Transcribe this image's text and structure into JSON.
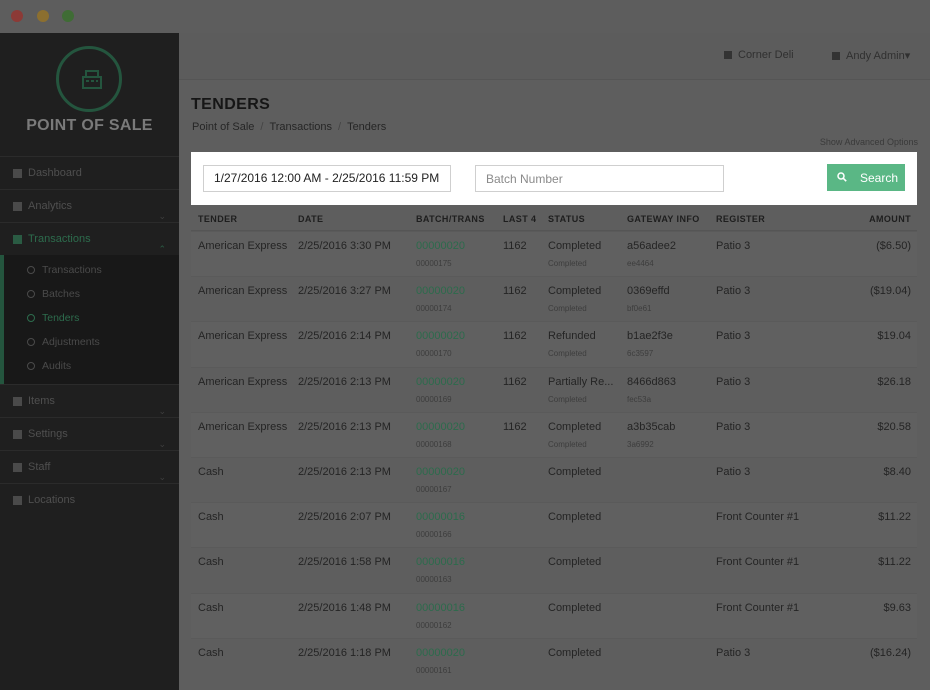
{
  "app": {
    "logo_text": "POINT OF SALE"
  },
  "sidebar": {
    "items": [
      {
        "label": "Dashboard",
        "icon": "dashboard-icon",
        "chevron": false
      },
      {
        "label": "Analytics",
        "icon": "chart-icon",
        "chevron": true
      },
      {
        "label": "Transactions",
        "icon": "cash-icon",
        "chevron": true,
        "active": true
      },
      {
        "label": "Items",
        "icon": "cart-icon",
        "chevron": true
      },
      {
        "label": "Settings",
        "icon": "sliders-icon",
        "chevron": true
      },
      {
        "label": "Staff",
        "icon": "users-icon",
        "chevron": true
      },
      {
        "label": "Locations",
        "icon": "home-icon",
        "chevron": false
      }
    ],
    "subitems": [
      {
        "label": "Transactions"
      },
      {
        "label": "Batches"
      },
      {
        "label": "Tenders",
        "active": true
      },
      {
        "label": "Adjustments"
      },
      {
        "label": "Audits"
      }
    ]
  },
  "topbar": {
    "store": "Corner Deli",
    "user": "Andy Admin",
    "user_caret": "▾"
  },
  "page": {
    "title": "TENDERS",
    "breadcrumb": [
      "Point of Sale",
      "Transactions",
      "Tenders"
    ],
    "breadcrumb_sep": "/",
    "advanced_link": "Show Advanced Options"
  },
  "search": {
    "date_range": "1/27/2016 12:00 AM - 2/25/2016 11:59 PM",
    "batch_placeholder": "Batch Number",
    "button_label": "Search"
  },
  "table": {
    "columns": [
      "TENDER",
      "DATE",
      "BATCH/TRANS",
      "LAST 4",
      "STATUS",
      "GATEWAY INFO",
      "REGISTER",
      "AMOUNT"
    ],
    "rows": [
      {
        "tender": "American Express",
        "date": "2/25/2016 3:30 PM",
        "batch": "00000020",
        "trans": "00000175",
        "last4": "1162",
        "status": "Completed",
        "status_sub": "Completed",
        "gateway": "a56adee2",
        "gateway_sub": "ee4464",
        "register": "Patio 3",
        "amount": "($6.50)"
      },
      {
        "tender": "American Express",
        "date": "2/25/2016 3:27 PM",
        "batch": "00000020",
        "trans": "00000174",
        "last4": "1162",
        "status": "Completed",
        "status_sub": "Completed",
        "gateway": "0369effd",
        "gateway_sub": "bf0e61",
        "register": "Patio 3",
        "amount": "($19.04)"
      },
      {
        "tender": "American Express",
        "date": "2/25/2016 2:14 PM",
        "batch": "00000020",
        "trans": "00000170",
        "last4": "1162",
        "status": "Refunded",
        "status_sub": "Completed",
        "gateway": "b1ae2f3e",
        "gateway_sub": "6c3597",
        "register": "Patio 3",
        "amount": "$19.04"
      },
      {
        "tender": "American Express",
        "date": "2/25/2016 2:13 PM",
        "batch": "00000020",
        "trans": "00000169",
        "last4": "1162",
        "status": "Partially Re...",
        "status_sub": "Completed",
        "gateway": "8466d863",
        "gateway_sub": "fec53a",
        "register": "Patio 3",
        "amount": "$26.18"
      },
      {
        "tender": "American Express",
        "date": "2/25/2016 2:13 PM",
        "batch": "00000020",
        "trans": "00000168",
        "last4": "1162",
        "status": "Completed",
        "status_sub": "Completed",
        "gateway": "a3b35cab",
        "gateway_sub": "3a6992",
        "register": "Patio 3",
        "amount": "$20.58"
      },
      {
        "tender": "Cash",
        "date": "2/25/2016 2:13 PM",
        "batch": "00000020",
        "trans": "00000167",
        "last4": "",
        "status": "Completed",
        "status_sub": "",
        "gateway": "",
        "gateway_sub": "",
        "register": "Patio 3",
        "amount": "$8.40"
      },
      {
        "tender": "Cash",
        "date": "2/25/2016 2:07 PM",
        "batch": "00000016",
        "trans": "00000166",
        "last4": "",
        "status": "Completed",
        "status_sub": "",
        "gateway": "",
        "gateway_sub": "",
        "register": "Front Counter #1",
        "amount": "$11.22"
      },
      {
        "tender": "Cash",
        "date": "2/25/2016 1:58 PM",
        "batch": "00000016",
        "trans": "00000163",
        "last4": "",
        "status": "Completed",
        "status_sub": "",
        "gateway": "",
        "gateway_sub": "",
        "register": "Front Counter #1",
        "amount": "$11.22"
      },
      {
        "tender": "Cash",
        "date": "2/25/2016 1:48 PM",
        "batch": "00000016",
        "trans": "00000162",
        "last4": "",
        "status": "Completed",
        "status_sub": "",
        "gateway": "",
        "gateway_sub": "",
        "register": "Front Counter #1",
        "amount": "$9.63"
      },
      {
        "tender": "Cash",
        "date": "2/25/2016 1:18 PM",
        "batch": "00000020",
        "trans": "00000161",
        "last4": "",
        "status": "Completed",
        "status_sub": "",
        "gateway": "",
        "gateway_sub": "",
        "register": "Patio 3",
        "amount": "($16.24)"
      }
    ]
  },
  "colors": {
    "accent": "#5ab785",
    "overlay": "#5e5e5e",
    "sidebar": "#1f1f1f"
  }
}
